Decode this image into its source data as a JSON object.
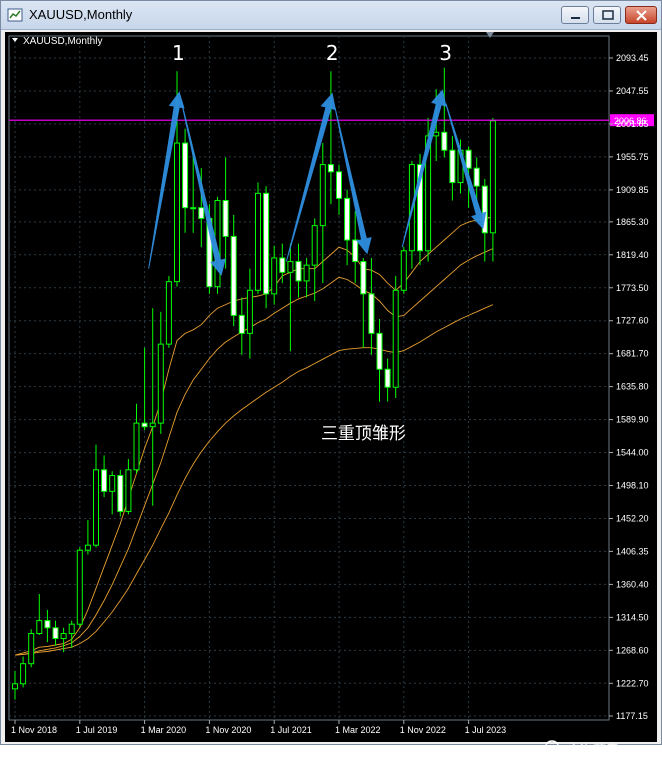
{
  "window": {
    "title": "XAUUSD,Monthly"
  },
  "chart_data": {
    "type": "candlestick",
    "symbol_label": "XAUUSD,Monthly",
    "y_ticks": [
      "2093.45",
      "2047.55",
      "2001.65",
      "1955.75",
      "1909.85",
      "1865.30",
      "1819.40",
      "1773.50",
      "1727.60",
      "1681.70",
      "1635.80",
      "1589.90",
      "1544.00",
      "1498.10",
      "1452.20",
      "1406.35",
      "1360.40",
      "1314.50",
      "1268.60",
      "1222.70",
      "1177.15"
    ],
    "y_tick_values": [
      2093.45,
      2047.55,
      2001.65,
      1955.75,
      1909.85,
      1865.3,
      1819.4,
      1773.5,
      1727.6,
      1681.7,
      1635.8,
      1589.9,
      1544.0,
      1498.1,
      1452.2,
      1406.35,
      1360.4,
      1314.5,
      1268.6,
      1222.7,
      1177.15
    ],
    "x_ticks": [
      "1 Nov 2018",
      "1 Jul 2019",
      "1 Mar 2020",
      "1 Nov 2020",
      "1 Jul 2021",
      "1 Mar 2022",
      "1 Nov 2022",
      "1 Jul 2023"
    ],
    "x_tick_index": [
      0,
      8,
      16,
      24,
      32,
      40,
      48,
      56
    ],
    "current_price_label": "2006.86",
    "current_price": 2006.86,
    "candles": [
      {
        "o": 1215,
        "h": 1240,
        "l": 1200,
        "c": 1222
      },
      {
        "o": 1222,
        "h": 1260,
        "l": 1217,
        "c": 1250
      },
      {
        "o": 1250,
        "h": 1298,
        "l": 1245,
        "c": 1292
      },
      {
        "o": 1292,
        "h": 1347,
        "l": 1290,
        "c": 1310
      },
      {
        "o": 1310,
        "h": 1325,
        "l": 1280,
        "c": 1300
      },
      {
        "o": 1300,
        "h": 1310,
        "l": 1275,
        "c": 1285
      },
      {
        "o": 1285,
        "h": 1300,
        "l": 1266,
        "c": 1292
      },
      {
        "o": 1292,
        "h": 1310,
        "l": 1272,
        "c": 1305
      },
      {
        "o": 1305,
        "h": 1412,
        "l": 1300,
        "c": 1408
      },
      {
        "o": 1408,
        "h": 1450,
        "l": 1402,
        "c": 1415
      },
      {
        "o": 1415,
        "h": 1555,
        "l": 1412,
        "c": 1520
      },
      {
        "o": 1520,
        "h": 1540,
        "l": 1482,
        "c": 1490
      },
      {
        "o": 1490,
        "h": 1518,
        "l": 1458,
        "c": 1512
      },
      {
        "o": 1512,
        "h": 1520,
        "l": 1455,
        "c": 1462
      },
      {
        "o": 1462,
        "h": 1535,
        "l": 1458,
        "c": 1520
      },
      {
        "o": 1520,
        "h": 1612,
        "l": 1515,
        "c": 1585
      },
      {
        "o": 1585,
        "h": 1690,
        "l": 1575,
        "c": 1580
      },
      {
        "o": 1580,
        "h": 1745,
        "l": 1470,
        "c": 1585
      },
      {
        "o": 1585,
        "h": 1740,
        "l": 1570,
        "c": 1695
      },
      {
        "o": 1695,
        "h": 1790,
        "l": 1690,
        "c": 1782
      },
      {
        "o": 1782,
        "h": 2075,
        "l": 1775,
        "c": 1975
      },
      {
        "o": 1975,
        "h": 1995,
        "l": 1850,
        "c": 1885
      },
      {
        "o": 1885,
        "h": 1965,
        "l": 1850,
        "c": 1885
      },
      {
        "o": 1885,
        "h": 1940,
        "l": 1830,
        "c": 1870
      },
      {
        "o": 1870,
        "h": 1890,
        "l": 1765,
        "c": 1775
      },
      {
        "o": 1775,
        "h": 1900,
        "l": 1765,
        "c": 1895
      },
      {
        "o": 1895,
        "h": 1955,
        "l": 1800,
        "c": 1845
      },
      {
        "o": 1845,
        "h": 1875,
        "l": 1720,
        "c": 1735
      },
      {
        "o": 1735,
        "h": 1760,
        "l": 1680,
        "c": 1710
      },
      {
        "o": 1710,
        "h": 1800,
        "l": 1675,
        "c": 1770
      },
      {
        "o": 1770,
        "h": 1920,
        "l": 1765,
        "c": 1905
      },
      {
        "o": 1905,
        "h": 1915,
        "l": 1745,
        "c": 1765
      },
      {
        "o": 1765,
        "h": 1832,
        "l": 1750,
        "c": 1815
      },
      {
        "o": 1815,
        "h": 1835,
        "l": 1780,
        "c": 1795
      },
      {
        "o": 1795,
        "h": 1835,
        "l": 1685,
        "c": 1810
      },
      {
        "o": 1810,
        "h": 1835,
        "l": 1760,
        "c": 1783
      },
      {
        "o": 1783,
        "h": 1815,
        "l": 1760,
        "c": 1805
      },
      {
        "o": 1805,
        "h": 1870,
        "l": 1755,
        "c": 1860
      },
      {
        "o": 1860,
        "h": 1975,
        "l": 1780,
        "c": 1945
      },
      {
        "o": 1945,
        "h": 2075,
        "l": 1890,
        "c": 1935
      },
      {
        "o": 1935,
        "h": 1945,
        "l": 1875,
        "c": 1898
      },
      {
        "o": 1898,
        "h": 1910,
        "l": 1805,
        "c": 1840
      },
      {
        "o": 1840,
        "h": 1880,
        "l": 1780,
        "c": 1810
      },
      {
        "o": 1810,
        "h": 1815,
        "l": 1690,
        "c": 1765
      },
      {
        "o": 1765,
        "h": 1815,
        "l": 1680,
        "c": 1710
      },
      {
        "o": 1710,
        "h": 1730,
        "l": 1615,
        "c": 1660
      },
      {
        "o": 1660,
        "h": 1675,
        "l": 1615,
        "c": 1635
      },
      {
        "o": 1635,
        "h": 1790,
        "l": 1620,
        "c": 1770
      },
      {
        "o": 1770,
        "h": 1830,
        "l": 1765,
        "c": 1825
      },
      {
        "o": 1825,
        "h": 1950,
        "l": 1800,
        "c": 1945
      },
      {
        "o": 1945,
        "h": 1960,
        "l": 1805,
        "c": 1825
      },
      {
        "o": 1825,
        "h": 2010,
        "l": 1810,
        "c": 1985
      },
      {
        "o": 1985,
        "h": 2050,
        "l": 1950,
        "c": 1990
      },
      {
        "o": 1990,
        "h": 2080,
        "l": 1955,
        "c": 1965
      },
      {
        "o": 1965,
        "h": 1985,
        "l": 1895,
        "c": 1920
      },
      {
        "o": 1920,
        "h": 1980,
        "l": 1905,
        "c": 1965
      },
      {
        "o": 1965,
        "h": 1970,
        "l": 1885,
        "c": 1940
      },
      {
        "o": 1940,
        "h": 1955,
        "l": 1895,
        "c": 1915
      },
      {
        "o": 1915,
        "h": 1925,
        "l": 1810,
        "c": 1850
      },
      {
        "o": 1850,
        "h": 2010,
        "l": 1810,
        "c": 2006
      }
    ],
    "ma_fast": [
      1262,
      1265,
      1268,
      1273,
      1274,
      1276,
      1278,
      1284,
      1300,
      1325,
      1355,
      1385,
      1415,
      1445,
      1480,
      1515,
      1550,
      1580,
      1615,
      1660,
      1700,
      1710,
      1715,
      1722,
      1735,
      1745,
      1750,
      1755,
      1758,
      1760,
      1762,
      1765,
      1775,
      1790,
      1795,
      1800,
      1800,
      1800,
      1810,
      1820,
      1830,
      1826,
      1816,
      1800,
      1798,
      1792,
      1780,
      1770,
      1780,
      1795,
      1810,
      1820,
      1830,
      1840,
      1850,
      1860,
      1865,
      1868,
      1870,
      1872
    ],
    "ma_mid": [
      1262,
      1263,
      1265,
      1268,
      1270,
      1272,
      1275,
      1279,
      1288,
      1300,
      1318,
      1338,
      1360,
      1385,
      1410,
      1440,
      1470,
      1500,
      1530,
      1565,
      1600,
      1625,
      1645,
      1660,
      1675,
      1688,
      1698,
      1705,
      1712,
      1718,
      1725,
      1730,
      1738,
      1745,
      1752,
      1758,
      1762,
      1766,
      1772,
      1780,
      1788,
      1785,
      1778,
      1770,
      1765,
      1755,
      1742,
      1733,
      1735,
      1745,
      1755,
      1765,
      1775,
      1785,
      1795,
      1805,
      1812,
      1818,
      1823,
      1828
    ],
    "ma_slow": [
      1262,
      1263,
      1264,
      1266,
      1267,
      1269,
      1271,
      1273,
      1278,
      1285,
      1295,
      1308,
      1322,
      1338,
      1355,
      1375,
      1395,
      1415,
      1438,
      1460,
      1485,
      1508,
      1528,
      1545,
      1560,
      1573,
      1585,
      1595,
      1604,
      1612,
      1620,
      1628,
      1635,
      1642,
      1650,
      1657,
      1662,
      1668,
      1674,
      1680,
      1686,
      1688,
      1689,
      1690,
      1690,
      1688,
      1685,
      1683,
      1686,
      1692,
      1698,
      1705,
      1712,
      1718,
      1724,
      1730,
      1735,
      1740,
      1745,
      1750
    ],
    "annotations": [
      {
        "text": "1",
        "index": 20
      },
      {
        "text": "2",
        "index": 39
      },
      {
        "text": "3",
        "index": 53
      }
    ],
    "arrows": [
      {
        "from": {
          "i": 16.5,
          "p": 1800
        },
        "to": {
          "i": 20.3,
          "p": 2047
        }
      },
      {
        "from": {
          "i": 20.5,
          "p": 2035
        },
        "to": {
          "i": 25.5,
          "p": 1790
        }
      },
      {
        "from": {
          "i": 33.5,
          "p": 1810
        },
        "to": {
          "i": 39.2,
          "p": 2045
        }
      },
      {
        "from": {
          "i": 39.5,
          "p": 2025
        },
        "to": {
          "i": 43.5,
          "p": 1820
        }
      },
      {
        "from": {
          "i": 47.8,
          "p": 1830
        },
        "to": {
          "i": 52.8,
          "p": 2050
        }
      },
      {
        "from": {
          "i": 53.2,
          "p": 2030
        },
        "to": {
          "i": 57.8,
          "p": 1855
        }
      }
    ],
    "pattern_label": "三重顶雏形",
    "pattern_label_pos": {
      "i": 39.5,
      "p": 1585
    },
    "grid": true,
    "colors": {
      "background": "#000000",
      "grid": "#2b3a44",
      "bull": "#00ff00",
      "bear_fill": "#ffffff",
      "price_line": "#ff00ff",
      "arrow": "#2e8ee0",
      "ma": "#e8a030",
      "text": "#ffffff"
    }
  },
  "watermark": {
    "text": "主次节奏"
  }
}
